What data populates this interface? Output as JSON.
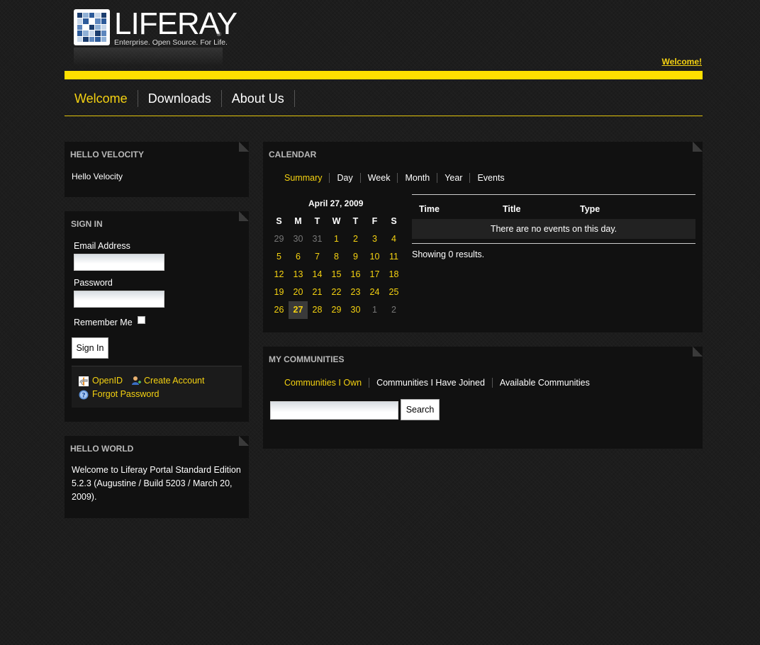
{
  "header": {
    "logo_word": "LIFERAY",
    "logo_tagline": "Enterprise. Open Source. For Life.",
    "logo_reg": "®",
    "welcome_link": "Welcome!"
  },
  "nav": {
    "items": [
      {
        "label": "Welcome",
        "active": true
      },
      {
        "label": "Downloads",
        "active": false
      },
      {
        "label": "About Us",
        "active": false
      }
    ]
  },
  "hello_velocity": {
    "title": "HELLO VELOCITY",
    "text": "Hello Velocity"
  },
  "sign_in": {
    "title": "SIGN IN",
    "email_label": "Email Address",
    "password_label": "Password",
    "remember_label": "Remember Me",
    "button_label": "Sign In",
    "openid_label": "OpenID",
    "create_account_label": "Create Account",
    "forgot_password_label": "Forgot Password"
  },
  "hello_world": {
    "title": "HELLO WORLD",
    "text": "Welcome to Liferay Portal Standard Edition 5.2.3 (Augustine / Build 5203 / March 20, 2009)."
  },
  "calendar": {
    "title": "CALENDAR",
    "tabs": [
      {
        "label": "Summary",
        "active": true
      },
      {
        "label": "Day",
        "active": false
      },
      {
        "label": "Week",
        "active": false
      },
      {
        "label": "Month",
        "active": false
      },
      {
        "label": "Year",
        "active": false
      },
      {
        "label": "Events",
        "active": false
      }
    ],
    "date_heading": "April 27, 2009",
    "weekdays": [
      "S",
      "M",
      "T",
      "W",
      "T",
      "F",
      "S"
    ],
    "weeks": [
      [
        {
          "d": "29",
          "t": "other"
        },
        {
          "d": "30",
          "t": "other"
        },
        {
          "d": "31",
          "t": "other"
        },
        {
          "d": "1",
          "t": "day"
        },
        {
          "d": "2",
          "t": "day"
        },
        {
          "d": "3",
          "t": "day"
        },
        {
          "d": "4",
          "t": "day"
        }
      ],
      [
        {
          "d": "5",
          "t": "day"
        },
        {
          "d": "6",
          "t": "day"
        },
        {
          "d": "7",
          "t": "day"
        },
        {
          "d": "8",
          "t": "day"
        },
        {
          "d": "9",
          "t": "day"
        },
        {
          "d": "10",
          "t": "day"
        },
        {
          "d": "11",
          "t": "day"
        }
      ],
      [
        {
          "d": "12",
          "t": "day"
        },
        {
          "d": "13",
          "t": "day"
        },
        {
          "d": "14",
          "t": "day"
        },
        {
          "d": "15",
          "t": "day"
        },
        {
          "d": "16",
          "t": "day"
        },
        {
          "d": "17",
          "t": "day"
        },
        {
          "d": "18",
          "t": "day"
        }
      ],
      [
        {
          "d": "19",
          "t": "day"
        },
        {
          "d": "20",
          "t": "day"
        },
        {
          "d": "21",
          "t": "day"
        },
        {
          "d": "22",
          "t": "day"
        },
        {
          "d": "23",
          "t": "day"
        },
        {
          "d": "24",
          "t": "day"
        },
        {
          "d": "25",
          "t": "day"
        }
      ],
      [
        {
          "d": "26",
          "t": "day"
        },
        {
          "d": "27",
          "t": "sel"
        },
        {
          "d": "28",
          "t": "day"
        },
        {
          "d": "29",
          "t": "day"
        },
        {
          "d": "30",
          "t": "day"
        },
        {
          "d": "1",
          "t": "other"
        },
        {
          "d": "2",
          "t": "other"
        }
      ]
    ],
    "columns": [
      "Time",
      "Title",
      "Type"
    ],
    "empty_message": "There are no events on this day.",
    "results_text": "Showing 0 results."
  },
  "communities": {
    "title": "MY COMMUNITIES",
    "tabs": [
      {
        "label": "Communities I Own",
        "active": true
      },
      {
        "label": "Communities I Have Joined",
        "active": false
      },
      {
        "label": "Available Communities",
        "active": false
      }
    ],
    "search_button": "Search"
  },
  "colors": {
    "accent_yellow": "#ffe000",
    "link_yellow": "#f5d211",
    "portlet_bg": "#111111"
  }
}
